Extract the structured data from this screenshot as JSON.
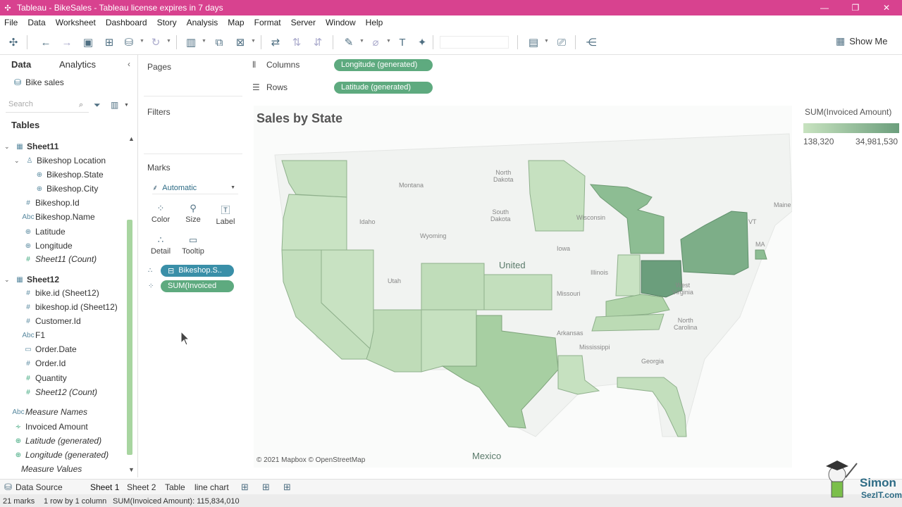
{
  "window": {
    "title": "Tableau - BikeSales - Tableau license expires in 7 days",
    "minimize": "—",
    "restore": "❐",
    "close": "✕"
  },
  "menu": [
    "File",
    "Data",
    "Worksheet",
    "Dashboard",
    "Story",
    "Analysis",
    "Map",
    "Format",
    "Server",
    "Window",
    "Help"
  ],
  "toolbar": {
    "show_me": "Show Me"
  },
  "data_pane": {
    "tab_data": "Data",
    "tab_analytics": "Analytics",
    "collapse": "‹",
    "datasource": "Bike sales",
    "search_placeholder": "Search",
    "tables_heading": "Tables",
    "tables": [
      {
        "name": "Sheet11",
        "fields": [
          "Bikeshop Location",
          "Bikeshop.State",
          "Bikeshop.City",
          "Bikeshop.Id",
          "Bikeshop.Name",
          "Latitude",
          "Longitude",
          "Sheet11 (Count)"
        ]
      },
      {
        "name": "Sheet12",
        "fields": [
          "bike.id (Sheet12)",
          "bikeshop.id (Sheet12)",
          "Customer.Id",
          "F1",
          "Order.Date",
          "Order.Id",
          "Quantity",
          "Sheet12 (Count)"
        ]
      }
    ],
    "extra_fields": [
      "Measure Names",
      "Invoiced Amount",
      "Latitude (generated)",
      "Longitude (generated)",
      "Measure Values"
    ]
  },
  "cards": {
    "pages": "Pages",
    "filters": "Filters",
    "marks": "Marks",
    "mark_type": "Automatic",
    "buttons": {
      "color": "Color",
      "size": "Size",
      "label": "Label",
      "detail": "Detail",
      "tooltip": "Tooltip"
    },
    "pills": [
      "Bikeshop.S..",
      "SUM(Invoiced"
    ]
  },
  "shelves": {
    "columns_label": "Columns",
    "columns_pill": "Longitude (generated)",
    "rows_label": "Rows",
    "rows_pill": "Latitude (generated)"
  },
  "view": {
    "title": "Sales by State",
    "attribution": "© 2021 Mapbox © OpenStreetMap",
    "map_labels": {
      "north_dakota": "North\nDakota",
      "montana": "Montana",
      "south_dakota": "South\nDakota",
      "idaho": "Idaho",
      "wyoming": "Wyoming",
      "wisconsin": "Wisconsin",
      "iowa": "Iowa",
      "illinois": "Illinois",
      "united": "United",
      "utah": "Utah",
      "missouri": "Missouri",
      "arkansas": "Arkansas",
      "mississippi": "Mississippi",
      "north_carolina": "North\nCarolina",
      "georgia": "Georgia",
      "west_virginia": "West\nVirginia",
      "maine": "Maine",
      "vt": "VT",
      "ma": "MA",
      "mexico": "Mexico"
    }
  },
  "legend": {
    "title": "SUM(Invoiced Amount)",
    "min": "138,320",
    "max": "34,981,530",
    "color_low": "#c8e3c0",
    "color_high": "#6b9e7c"
  },
  "sheet_tabs": {
    "datasource": "Data Source",
    "tabs": [
      "Sheet 1",
      "Sheet 2",
      "Table",
      "line chart"
    ]
  },
  "status": {
    "marks": "21 marks",
    "rows_cols": "1 row by 1 column",
    "sum": "SUM(Invoiced Amount): 115,834,010"
  },
  "logo": {
    "text1": "Simon",
    "text2": "SezIT.com"
  }
}
